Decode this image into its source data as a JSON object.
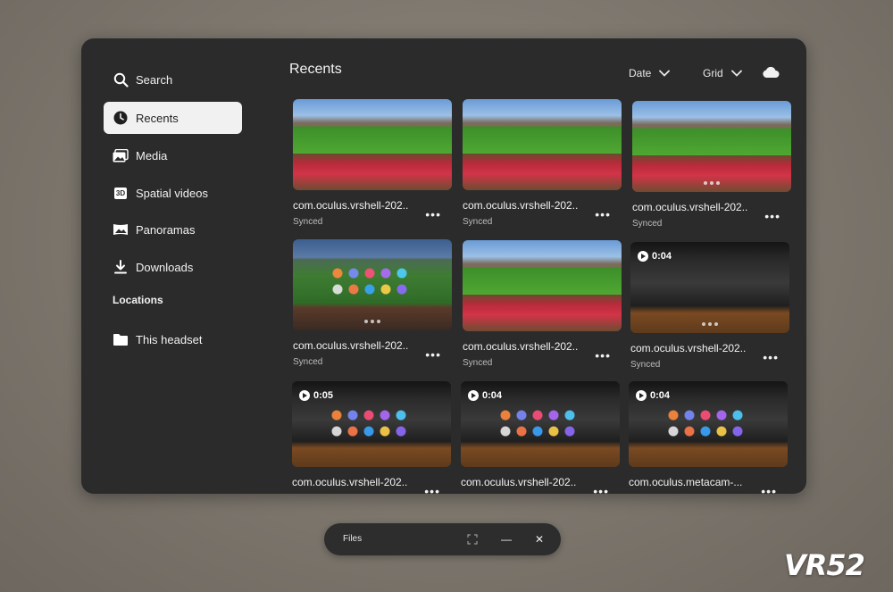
{
  "sidebar": {
    "items": [
      {
        "label": "Search",
        "icon": "search-icon"
      },
      {
        "label": "Recents",
        "icon": "clock-icon",
        "active": true
      },
      {
        "label": "Media",
        "icon": "photos-icon"
      },
      {
        "label": "Spatial videos",
        "icon": "3d-icon",
        "badge": "3D"
      },
      {
        "label": "Panoramas",
        "icon": "panorama-icon"
      },
      {
        "label": "Downloads",
        "icon": "download-icon"
      }
    ],
    "locations_label": "Locations",
    "locations": [
      {
        "label": "This headset",
        "icon": "folder-icon"
      }
    ]
  },
  "main": {
    "title": "Recents",
    "sort_label": "Date",
    "view_label": "Grid",
    "cloud_icon": "cloud-icon"
  },
  "tiles": [
    {
      "name": "com.oculus.vrshell-202..",
      "status": "Synced",
      "thumb": "golf",
      "duration": ""
    },
    {
      "name": "com.oculus.vrshell-202..",
      "status": "Synced",
      "thumb": "golf",
      "duration": ""
    },
    {
      "name": "com.oculus.vrshell-202..",
      "status": "Synced",
      "thumb": "golf",
      "duration": ""
    },
    {
      "name": "com.oculus.vrshell-202..",
      "status": "Synced",
      "thumb": "home",
      "duration": ""
    },
    {
      "name": "com.oculus.vrshell-202..",
      "status": "Synced",
      "thumb": "golf",
      "duration": ""
    },
    {
      "name": "com.oculus.vrshell-202..",
      "status": "Synced",
      "thumb": "dark",
      "duration": "0:04"
    },
    {
      "name": "com.oculus.vrshell-202..",
      "status": "",
      "thumb": "dark",
      "duration": "0:05"
    },
    {
      "name": "com.oculus.vrshell-202..",
      "status": "",
      "thumb": "dark",
      "duration": "0:04"
    },
    {
      "name": "com.oculus.metacam-...",
      "status": "",
      "thumb": "dark",
      "duration": "0:04"
    }
  ],
  "more_glyph": "•••",
  "taskbar": {
    "label": "Files",
    "minimize_glyph": "—",
    "close_glyph": "✕"
  },
  "watermark": "VR52"
}
